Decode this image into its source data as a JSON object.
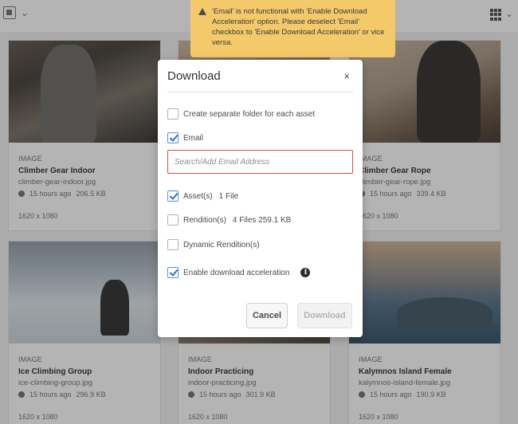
{
  "toast": {
    "message": "'Email' is not functional with 'Enable Download Acceleration' option. Please deselect 'Email' checkbox to 'Enable Download Acceleration' or vice versa."
  },
  "dialog": {
    "title": "Download",
    "close_label": "×",
    "options": {
      "separate_folder": {
        "label": "Create separate folder for each asset",
        "checked": false
      },
      "email": {
        "label": "Email",
        "checked": true
      },
      "assets": {
        "label": "Asset(s)",
        "extra": "1 File",
        "checked": true
      },
      "renditions": {
        "label": "Rendition(s)",
        "extra": "4 Files 259.1 KB",
        "checked": false
      },
      "dynamic_renditions": {
        "label": "Dynamic Rendition(s)",
        "checked": false
      },
      "acceleration": {
        "label": "Enable download acceleration",
        "checked": true
      }
    },
    "email_placeholder": "Search/Add Email Address",
    "cancel_label": "Cancel",
    "download_label": "Download"
  },
  "cards": [
    {
      "type": "IMAGE",
      "title": "Climber Gear Indoor",
      "file": "climber-gear-indoor.jpg",
      "time": "15 hours ago",
      "size": "206.5 KB",
      "dims": "1620 x 1080"
    },
    {
      "type": "IMAGE",
      "title": "Climber Gear Rope",
      "file": "climber-gear-rope.jpg",
      "time": "15 hours ago",
      "size": "339.4 KB",
      "dims": "1620 x 1080"
    },
    {
      "type": "IMAGE",
      "title": "Ice Climbing Group",
      "file": "ice-climbing-group.jpg",
      "time": "15 hours ago",
      "size": "296.9 KB",
      "dims": "1620 x 1080"
    },
    {
      "type": "IMAGE",
      "title": "Indoor Practicing",
      "file": "indoor-practicing.jpg",
      "time": "15 hours ago",
      "size": "301.9 KB",
      "dims": "1620 x 1080"
    },
    {
      "type": "IMAGE",
      "title": "Kalymnos Island Female",
      "file": "kalymnos-island-female.jpg",
      "time": "15 hours ago",
      "size": "190.9 KB",
      "dims": "1620 x 1080"
    }
  ],
  "colors": {
    "accent": "#2d72d2",
    "error": "#d7513b",
    "toast": "#f4c96a"
  },
  "icons": {
    "select": "select-all-icon",
    "view": "card-view-icon",
    "warning": "alert-icon",
    "info": "info-icon",
    "globe": "globe-icon"
  }
}
